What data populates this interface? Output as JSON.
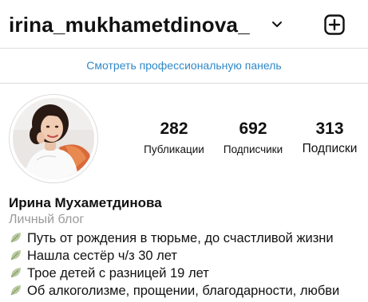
{
  "header": {
    "username": "irina_mukhametdinova_",
    "switch_account_icon": "chevron-down-icon",
    "create_icon": "plus-square-icon"
  },
  "professional_dashboard": {
    "label": "Смотреть профессиональную панель",
    "color": "#2f89c8"
  },
  "profile": {
    "avatar_icon": "profile-photo",
    "stats": {
      "posts": {
        "value": "282",
        "label": "Публикации"
      },
      "followers": {
        "value": "692",
        "label": "Подписчики"
      },
      "following": {
        "value": "313",
        "label": "Подписки"
      }
    },
    "name": "Ирина Мухаметдинова",
    "category": "Личный блог",
    "bio": [
      {
        "icon": "leaf-emoji",
        "text": "Путь от рождения в тюрьме, до счастливой жизни"
      },
      {
        "icon": "leaf-emoji",
        "text": "Нашла сестёр ч/з 30 лет"
      },
      {
        "icon": "leaf-emoji",
        "text": "Трое детей с разницей 19 лет"
      },
      {
        "icon": "leaf-emoji",
        "text": "Об алкоголизме, прощении, благодарности, любви"
      }
    ]
  }
}
